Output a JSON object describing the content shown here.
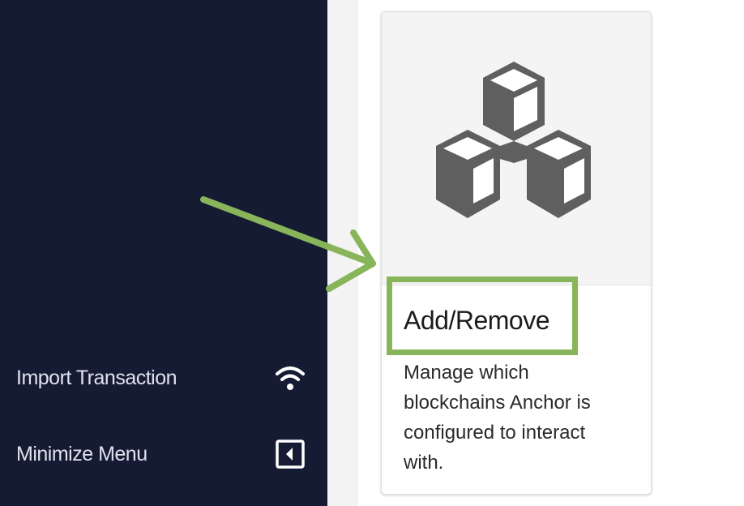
{
  "sidebar": {
    "items": [
      {
        "label": "Import Transaction",
        "icon": "wifi-icon"
      },
      {
        "label": "Minimize Menu",
        "icon": "collapse-left-icon"
      }
    ]
  },
  "card": {
    "icon": "cubes-icon",
    "title": "Add/Remove",
    "description": "Manage which blockchains Anchor is configured to interact with."
  },
  "annotation": {
    "arrow_color": "#89b55a",
    "highlight_color": "#89b55a"
  },
  "colors": {
    "sidebar_bg": "#151b33",
    "sidebar_text": "#dfe2ec",
    "icon_gray": "#5f5f5f"
  }
}
